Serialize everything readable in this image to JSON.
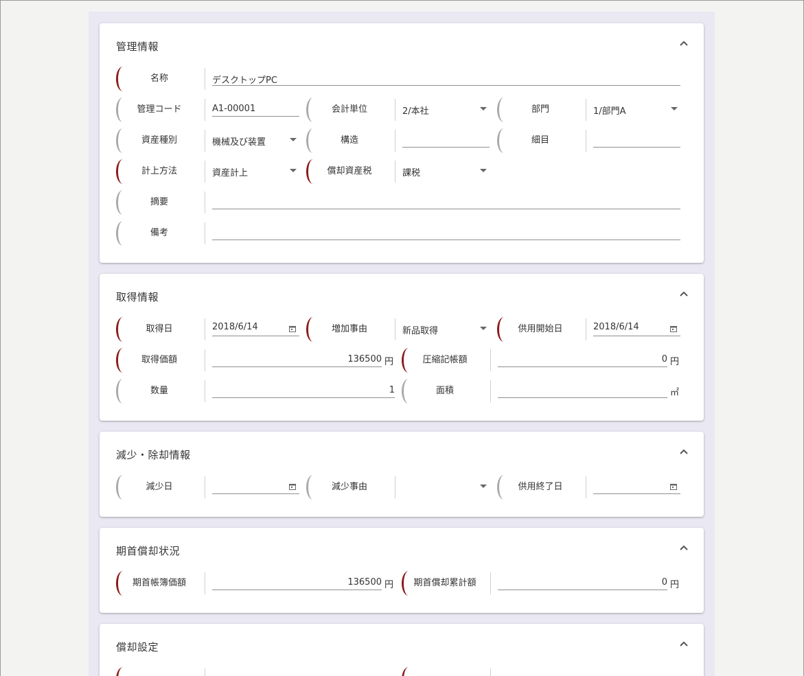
{
  "sections": {
    "management": {
      "title": "管理情報",
      "name_label": "名称",
      "name_value": "デスクトップPC",
      "code_label": "管理コード",
      "code_value": "A1-00001",
      "accounting_unit_label": "会計単位",
      "accounting_unit_value": "2/本社",
      "department_label": "部門",
      "department_value": "1/部門A",
      "asset_type_label": "資産種別",
      "asset_type_value": "機械及び装置",
      "structure_label": "構造",
      "structure_value": "",
      "detail_label": "細目",
      "detail_value": "",
      "method_label": "計上方法",
      "method_value": "資産計上",
      "tax_label": "償却資産税",
      "tax_value": "課税",
      "summary_label": "摘要",
      "summary_value": "",
      "remarks_label": "備考",
      "remarks_value": ""
    },
    "acquisition": {
      "title": "取得情報",
      "date_label": "取得日",
      "date_value": "2018/6/14",
      "reason_label": "増加事由",
      "reason_value": "新品取得",
      "service_start_label": "供用開始日",
      "service_start_value": "2018/6/14",
      "price_label": "取得価額",
      "price_value": "136500",
      "price_unit": "円",
      "compressed_label": "圧縮記帳額",
      "compressed_value": "0",
      "compressed_unit": "円",
      "quantity_label": "数量",
      "quantity_value": "1",
      "area_label": "面積",
      "area_value": "",
      "area_unit": "㎡"
    },
    "disposal": {
      "title": "減少・除却情報",
      "date_label": "減少日",
      "date_value": "",
      "reason_label": "減少事由",
      "reason_value": "",
      "service_end_label": "供用終了日",
      "service_end_value": ""
    },
    "opening": {
      "title": "期首償却状況",
      "book_value_label": "期首帳簿価額",
      "book_value_value": "136500",
      "book_value_unit": "円",
      "accum_label": "期首償却累計額",
      "accum_value": "0",
      "accum_unit": "円"
    },
    "depreciation": {
      "title": "償却設定"
    }
  },
  "icons": {
    "collapse": "chevron-up-icon",
    "dropdown": "dropdown-caret-icon",
    "calendar": "calendar-icon"
  },
  "colors": {
    "required_bracket": "#8b1a1a",
    "optional_bracket": "#a9a9a9",
    "panel_background": "#e9e8f3"
  }
}
